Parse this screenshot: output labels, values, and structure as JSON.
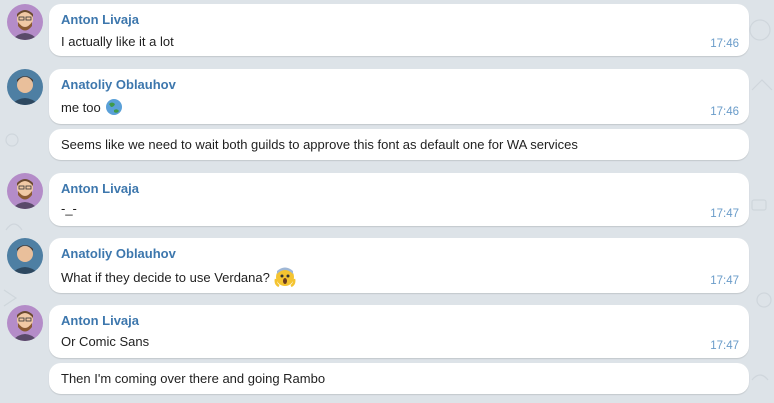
{
  "messages": [
    {
      "author": "Anton Livaja",
      "text": "I actually like it a lot",
      "time": "17:46"
    },
    {
      "author": "Anatoliy Oblauhov",
      "text": "me too",
      "time": "17:46",
      "emoji": "earth-globe-emoji"
    },
    {
      "text": "Seems like we need to wait both guilds to approve this font as default one for WA services"
    },
    {
      "author": "Anton Livaja",
      "text": "-_-",
      "time": "17:47"
    },
    {
      "author": "Anatoliy Oblauhov",
      "text": "What if they decide to use Verdana?",
      "time": "17:47",
      "emoji": "screaming-face-emoji"
    },
    {
      "author": "Anton Livaja",
      "text": "Or Comic Sans",
      "time": "17:47"
    },
    {
      "text": "Then I'm coming over there and going Rambo"
    }
  ],
  "colors": {
    "background": "#dde3e8",
    "author_name": "#3d77ad",
    "timestamp": "#6a9cc9",
    "bubble": "#ffffff"
  }
}
